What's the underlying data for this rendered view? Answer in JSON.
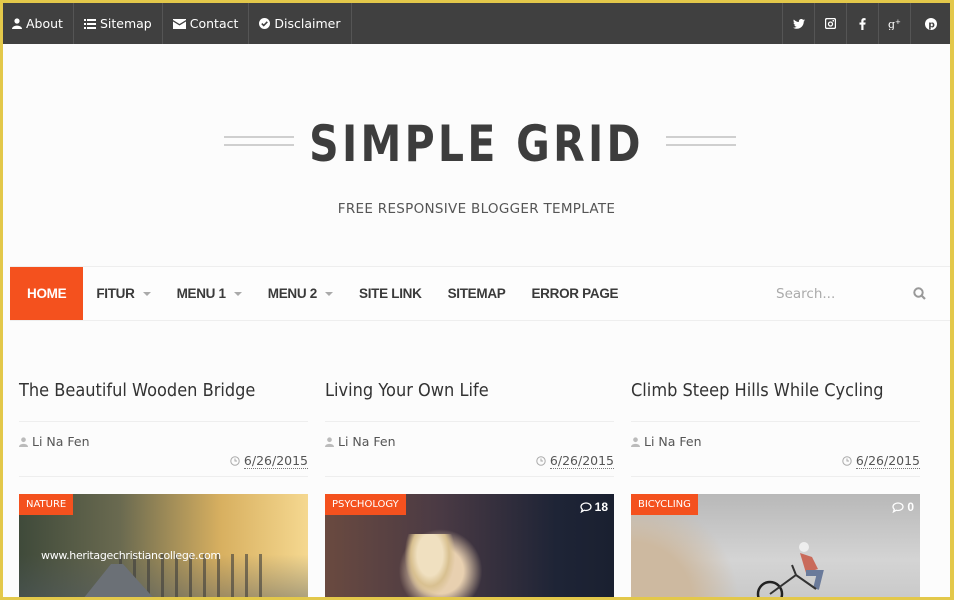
{
  "topbar": {
    "links": [
      {
        "label": "About",
        "icon": "user-icon"
      },
      {
        "label": "Sitemap",
        "icon": "list-icon"
      },
      {
        "label": "Contact",
        "icon": "envelope-icon"
      },
      {
        "label": "Disclaimer",
        "icon": "check-circle-icon"
      }
    ],
    "social": [
      "twitter-icon",
      "instagram-icon",
      "facebook-icon",
      "google-plus-icon",
      "pinterest-icon"
    ]
  },
  "header": {
    "title": "SIMPLE GRID",
    "tagline": "FREE RESPONSIVE BLOGGER TEMPLATE"
  },
  "nav": {
    "items": [
      {
        "label": "HOME",
        "active": true,
        "dropdown": false
      },
      {
        "label": "FITUR",
        "active": false,
        "dropdown": true
      },
      {
        "label": "MENU 1",
        "active": false,
        "dropdown": true
      },
      {
        "label": "MENU 2",
        "active": false,
        "dropdown": true
      },
      {
        "label": "SITE LINK",
        "active": false,
        "dropdown": false
      },
      {
        "label": "SITEMAP",
        "active": false,
        "dropdown": false
      },
      {
        "label": "ERROR PAGE",
        "active": false,
        "dropdown": false
      }
    ],
    "search_placeholder": "Search...",
    "accent_color": "#f4511e"
  },
  "posts": [
    {
      "title": "The Beautiful Wooden Bridge",
      "author": "Li Na Fen",
      "date": "6/26/2015",
      "category": "NATURE",
      "comments": null,
      "watermark": "www.heritagechristiancollege.com"
    },
    {
      "title": "Living Your Own Life",
      "author": "Li Na Fen",
      "date": "6/26/2015",
      "category": "PSYCHOLOGY",
      "comments": "18"
    },
    {
      "title": "Climb Steep Hills While Cycling",
      "author": "Li Na Fen",
      "date": "6/26/2015",
      "category": "BICYCLING",
      "comments": "0"
    }
  ]
}
